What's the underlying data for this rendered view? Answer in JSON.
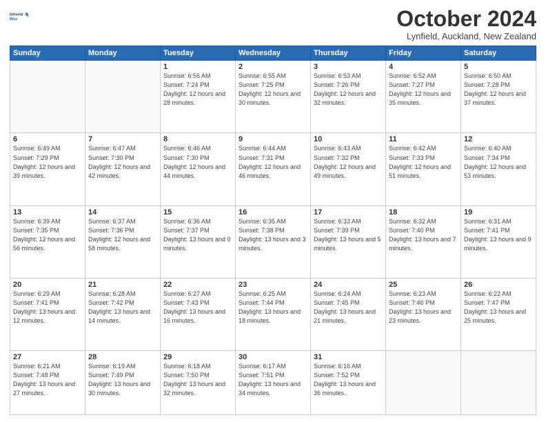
{
  "logo": {
    "line1": "General",
    "line2": "Blue"
  },
  "title": "October 2024",
  "location": "Lynfield, Auckland, New Zealand",
  "days_header": [
    "Sunday",
    "Monday",
    "Tuesday",
    "Wednesday",
    "Thursday",
    "Friday",
    "Saturday"
  ],
  "weeks": [
    [
      {
        "num": "",
        "sunrise": "",
        "sunset": "",
        "daylight": ""
      },
      {
        "num": "",
        "sunrise": "",
        "sunset": "",
        "daylight": ""
      },
      {
        "num": "1",
        "sunrise": "Sunrise: 6:56 AM",
        "sunset": "Sunset: 7:24 PM",
        "daylight": "Daylight: 12 hours and 28 minutes."
      },
      {
        "num": "2",
        "sunrise": "Sunrise: 6:55 AM",
        "sunset": "Sunset: 7:25 PM",
        "daylight": "Daylight: 12 hours and 30 minutes."
      },
      {
        "num": "3",
        "sunrise": "Sunrise: 6:53 AM",
        "sunset": "Sunset: 7:26 PM",
        "daylight": "Daylight: 12 hours and 32 minutes."
      },
      {
        "num": "4",
        "sunrise": "Sunrise: 6:52 AM",
        "sunset": "Sunset: 7:27 PM",
        "daylight": "Daylight: 12 hours and 35 minutes."
      },
      {
        "num": "5",
        "sunrise": "Sunrise: 6:50 AM",
        "sunset": "Sunset: 7:28 PM",
        "daylight": "Daylight: 12 hours and 37 minutes."
      }
    ],
    [
      {
        "num": "6",
        "sunrise": "Sunrise: 6:49 AM",
        "sunset": "Sunset: 7:29 PM",
        "daylight": "Daylight: 12 hours and 39 minutes."
      },
      {
        "num": "7",
        "sunrise": "Sunrise: 6:47 AM",
        "sunset": "Sunset: 7:30 PM",
        "daylight": "Daylight: 12 hours and 42 minutes."
      },
      {
        "num": "8",
        "sunrise": "Sunrise: 6:46 AM",
        "sunset": "Sunset: 7:30 PM",
        "daylight": "Daylight: 12 hours and 44 minutes."
      },
      {
        "num": "9",
        "sunrise": "Sunrise: 6:44 AM",
        "sunset": "Sunset: 7:31 PM",
        "daylight": "Daylight: 12 hours and 46 minutes."
      },
      {
        "num": "10",
        "sunrise": "Sunrise: 6:43 AM",
        "sunset": "Sunset: 7:32 PM",
        "daylight": "Daylight: 12 hours and 49 minutes."
      },
      {
        "num": "11",
        "sunrise": "Sunrise: 6:42 AM",
        "sunset": "Sunset: 7:33 PM",
        "daylight": "Daylight: 12 hours and 51 minutes."
      },
      {
        "num": "12",
        "sunrise": "Sunrise: 6:40 AM",
        "sunset": "Sunset: 7:34 PM",
        "daylight": "Daylight: 12 hours and 53 minutes."
      }
    ],
    [
      {
        "num": "13",
        "sunrise": "Sunrise: 6:39 AM",
        "sunset": "Sunset: 7:35 PM",
        "daylight": "Daylight: 12 hours and 56 minutes."
      },
      {
        "num": "14",
        "sunrise": "Sunrise: 6:37 AM",
        "sunset": "Sunset: 7:36 PM",
        "daylight": "Daylight: 12 hours and 58 minutes."
      },
      {
        "num": "15",
        "sunrise": "Sunrise: 6:36 AM",
        "sunset": "Sunset: 7:37 PM",
        "daylight": "Daylight: 13 hours and 0 minutes."
      },
      {
        "num": "16",
        "sunrise": "Sunrise: 6:35 AM",
        "sunset": "Sunset: 7:38 PM",
        "daylight": "Daylight: 13 hours and 3 minutes."
      },
      {
        "num": "17",
        "sunrise": "Sunrise: 6:33 AM",
        "sunset": "Sunset: 7:39 PM",
        "daylight": "Daylight: 13 hours and 5 minutes."
      },
      {
        "num": "18",
        "sunrise": "Sunrise: 6:32 AM",
        "sunset": "Sunset: 7:40 PM",
        "daylight": "Daylight: 13 hours and 7 minutes."
      },
      {
        "num": "19",
        "sunrise": "Sunrise: 6:31 AM",
        "sunset": "Sunset: 7:41 PM",
        "daylight": "Daylight: 13 hours and 9 minutes."
      }
    ],
    [
      {
        "num": "20",
        "sunrise": "Sunrise: 6:29 AM",
        "sunset": "Sunset: 7:41 PM",
        "daylight": "Daylight: 13 hours and 12 minutes."
      },
      {
        "num": "21",
        "sunrise": "Sunrise: 6:28 AM",
        "sunset": "Sunset: 7:42 PM",
        "daylight": "Daylight: 13 hours and 14 minutes."
      },
      {
        "num": "22",
        "sunrise": "Sunrise: 6:27 AM",
        "sunset": "Sunset: 7:43 PM",
        "daylight": "Daylight: 13 hours and 16 minutes."
      },
      {
        "num": "23",
        "sunrise": "Sunrise: 6:25 AM",
        "sunset": "Sunset: 7:44 PM",
        "daylight": "Daylight: 13 hours and 18 minutes."
      },
      {
        "num": "24",
        "sunrise": "Sunrise: 6:24 AM",
        "sunset": "Sunset: 7:45 PM",
        "daylight": "Daylight: 13 hours and 21 minutes."
      },
      {
        "num": "25",
        "sunrise": "Sunrise: 6:23 AM",
        "sunset": "Sunset: 7:46 PM",
        "daylight": "Daylight: 13 hours and 23 minutes."
      },
      {
        "num": "26",
        "sunrise": "Sunrise: 6:22 AM",
        "sunset": "Sunset: 7:47 PM",
        "daylight": "Daylight: 13 hours and 25 minutes."
      }
    ],
    [
      {
        "num": "27",
        "sunrise": "Sunrise: 6:21 AM",
        "sunset": "Sunset: 7:48 PM",
        "daylight": "Daylight: 13 hours and 27 minutes."
      },
      {
        "num": "28",
        "sunrise": "Sunrise: 6:19 AM",
        "sunset": "Sunset: 7:49 PM",
        "daylight": "Daylight: 13 hours and 30 minutes."
      },
      {
        "num": "29",
        "sunrise": "Sunrise: 6:18 AM",
        "sunset": "Sunset: 7:50 PM",
        "daylight": "Daylight: 13 hours and 32 minutes."
      },
      {
        "num": "30",
        "sunrise": "Sunrise: 6:17 AM",
        "sunset": "Sunset: 7:51 PM",
        "daylight": "Daylight: 13 hours and 34 minutes."
      },
      {
        "num": "31",
        "sunrise": "Sunrise: 6:16 AM",
        "sunset": "Sunset: 7:52 PM",
        "daylight": "Daylight: 13 hours and 36 minutes."
      },
      {
        "num": "",
        "sunrise": "",
        "sunset": "",
        "daylight": ""
      },
      {
        "num": "",
        "sunrise": "",
        "sunset": "",
        "daylight": ""
      }
    ]
  ]
}
